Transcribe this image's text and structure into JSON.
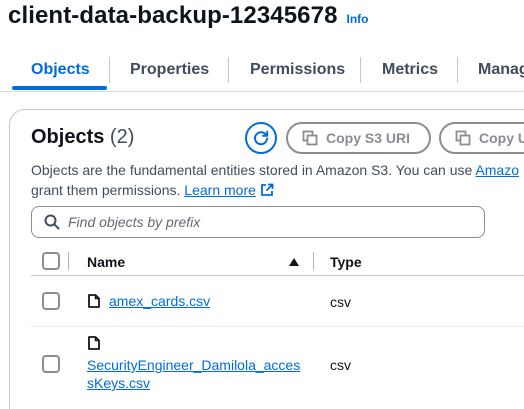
{
  "bucket": {
    "title": "client-data-backup-12345678",
    "info": "Info"
  },
  "tabs": [
    {
      "label": "Objects"
    },
    {
      "label": "Properties"
    },
    {
      "label": "Permissions"
    },
    {
      "label": "Metrics"
    },
    {
      "label": "Manag"
    }
  ],
  "objects": {
    "title": "Objects",
    "count": "(2)",
    "copy_s3_uri": "Copy S3 URI",
    "copy_url": "Copy U",
    "description_line1": "Objects are the fundamental entities stored in Amazon S3. You can use",
    "description_link": "Amazo",
    "description_line2": "grant them permissions.",
    "learn_more": "Learn more",
    "search_placeholder": "Find objects by prefix",
    "columns": {
      "name": "Name",
      "type": "Type"
    },
    "rows": [
      {
        "name": "amex_cards.csv",
        "type": "csv"
      },
      {
        "name_line1": "SecurityEngineer_Damilola_acces",
        "name_line2": "sKeys.csv",
        "type": "csv"
      }
    ]
  },
  "colors": {
    "accent": "#006ce0",
    "text": "#0f141a",
    "muted": "#414d5c",
    "disabled": "#8c8c94"
  }
}
